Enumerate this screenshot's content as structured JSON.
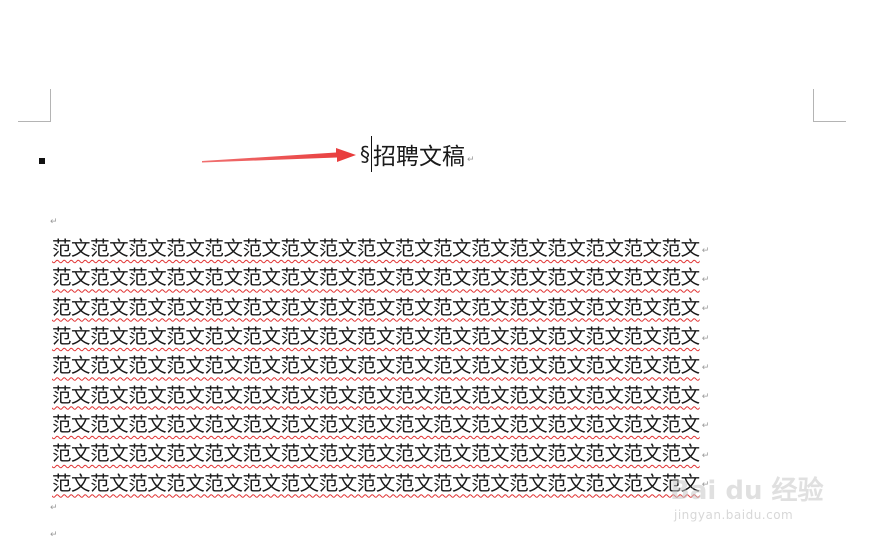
{
  "document": {
    "heading_prefix": "§",
    "heading_text": "招聘文稿",
    "paragraph_mark": "↵",
    "body_lines": [
      "范文范文范文范文范文范文范文范文范文范文范文范文范文范文范文范文范文",
      "范文范文范文范文范文范文范文范文范文范文范文范文范文范文范文范文范文",
      "范文范文范文范文范文范文范文范文范文范文范文范文范文范文范文范文范文",
      "范文范文范文范文范文范文范文范文范文范文范文范文范文范文范文范文范文",
      "范文范文范文范文范文范文范文范文范文范文范文范文范文范文范文范文范文",
      "范文范文范文范文范文范文范文范文范文范文范文范文范文范文范文范文范文",
      "范文范文范文范文范文范文范文范文范文范文范文范文范文范文范文范文范文",
      "范文范文范文范文范文范文范文范文范文范文范文范文范文范文范文范文范文",
      "范文范文范文范文范文范文范文范文范文范文范文范文范文范文范文范文范文"
    ]
  },
  "annotation": {
    "arrow_color": "#e83a3a"
  },
  "watermark": {
    "brand": "Bai du 经验",
    "url": "jingyan.baidu.com"
  },
  "colors": {
    "spellcheck_underline": "#e03030",
    "corner_marks": "#b4b4b4",
    "paragraph_mark": "#9a9a9a"
  }
}
